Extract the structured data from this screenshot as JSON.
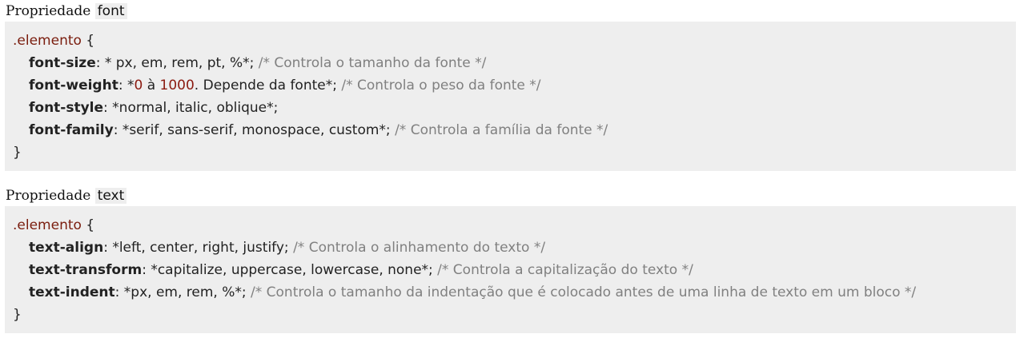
{
  "sections": [
    {
      "heading_prefix": "Propriedade",
      "heading_code": "font",
      "selector": ".elemento",
      "open_brace": " {",
      "close_brace": "}",
      "lines": [
        {
          "prop": "font-size",
          "pre": ": * px, em, rem, pt, %*; ",
          "num": "",
          "post": "",
          "comment": "/* Controla o tamanho da fonte */"
        },
        {
          "prop": "font-weight",
          "pre": ": *",
          "num": "0",
          "mid": " à ",
          "num2": "1000",
          "post": ". Depende da fonte*; ",
          "comment": "/* Controla o peso da fonte */"
        },
        {
          "prop": "font-style",
          "pre": ": *normal, italic, oblique*;",
          "num": "",
          "post": "",
          "comment": ""
        },
        {
          "prop": "font-family",
          "pre": ": *serif, sans-serif, monospace, custom*; ",
          "num": "",
          "post": "",
          "comment": "/* Controla a família da fonte */"
        }
      ]
    },
    {
      "heading_prefix": "Propriedade",
      "heading_code": "text",
      "selector": ".elemento",
      "open_brace": " {",
      "close_brace": "}",
      "lines": [
        {
          "prop": "text-align",
          "pre": ": *left, center, right, justify; ",
          "comment": "/* Controla o alinhamento do texto */"
        },
        {
          "prop": "text-transform",
          "pre": ": *capitalize, uppercase, lowercase, none*; ",
          "comment": "/* Controla a capitalização do texto */"
        },
        {
          "prop": "text-indent",
          "pre": ": *px, em, rem, %*; ",
          "comment": "/* Controla o tamanho da indentação que é colocado antes de uma linha de texto em um bloco */"
        }
      ]
    }
  ]
}
